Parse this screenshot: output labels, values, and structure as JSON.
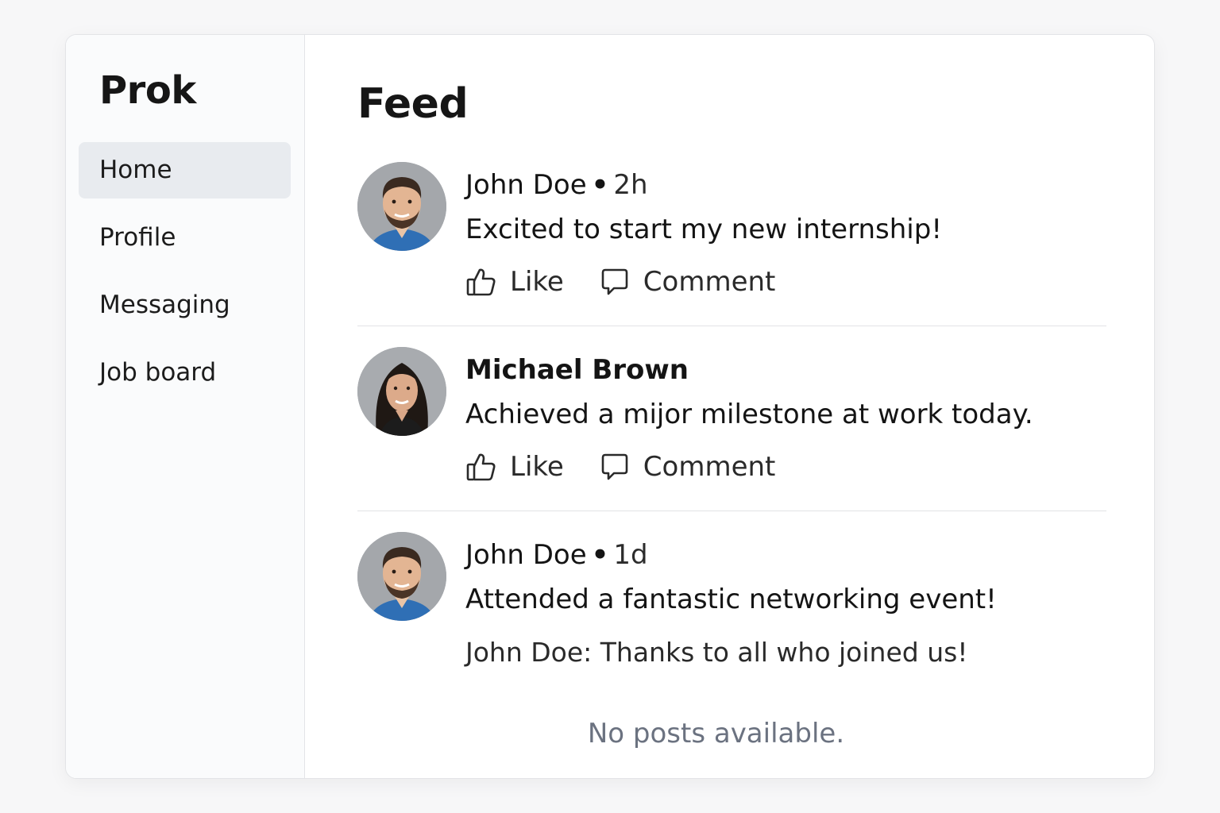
{
  "app": {
    "brand": "Prok"
  },
  "sidebar": {
    "items": [
      {
        "label": "Home"
      },
      {
        "label": "Profile"
      },
      {
        "label": "Messaging"
      },
      {
        "label": "Job board"
      }
    ]
  },
  "feed": {
    "title": "Feed",
    "posts": [
      {
        "author": "John Doe",
        "separator": "•",
        "time": "2h",
        "text": "Excited to start my new internship!",
        "like_label": "Like",
        "comment_label": "Comment"
      },
      {
        "author": "Michael Brown",
        "text": "Achieved a mijor milestone at work today.",
        "like_label": "Like",
        "comment_label": "Comment"
      },
      {
        "author": "John Doe",
        "separator": "•",
        "time": "1d",
        "text": "Attended a fantastic networking event!",
        "comment": "John Doe: Thanks to all who joined us!"
      }
    ],
    "empty_state": "No posts available."
  },
  "icons": {
    "like": "thumbs-up-icon",
    "comment": "comment-bubble-icon"
  },
  "colors": {
    "sidebar_active": "#e8ebef",
    "muted_text": "#6b7280"
  }
}
